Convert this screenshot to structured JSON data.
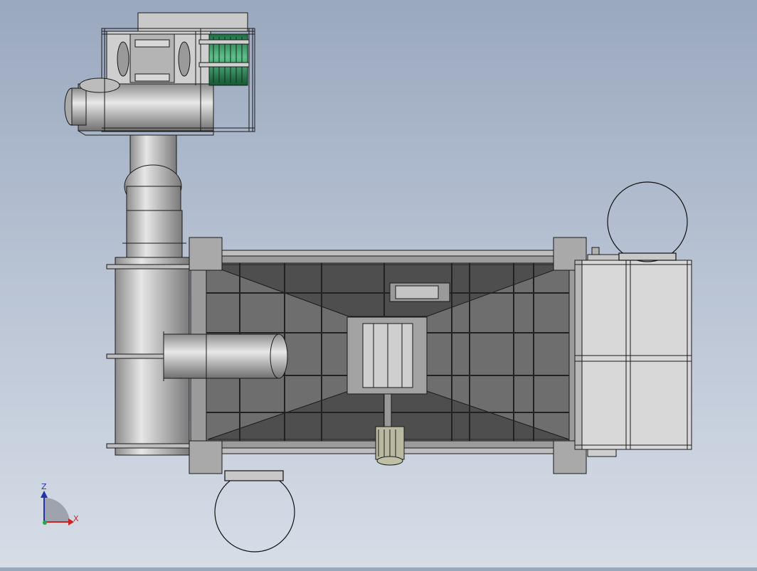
{
  "viewport": {
    "background_top": "#9aa8be",
    "background_bottom": "#d6dde7"
  },
  "model": {
    "steel_color": "#c8c8c8",
    "frame_color": "#8a8a8a",
    "dark_panel_color": "#6e6e6e",
    "motor_color": "#2e8b57",
    "outline_color": "#1a1a1a"
  },
  "triad": {
    "z_label": "Z",
    "x_label": "X",
    "z_color": "#2233aa",
    "x_color": "#cc2222"
  }
}
